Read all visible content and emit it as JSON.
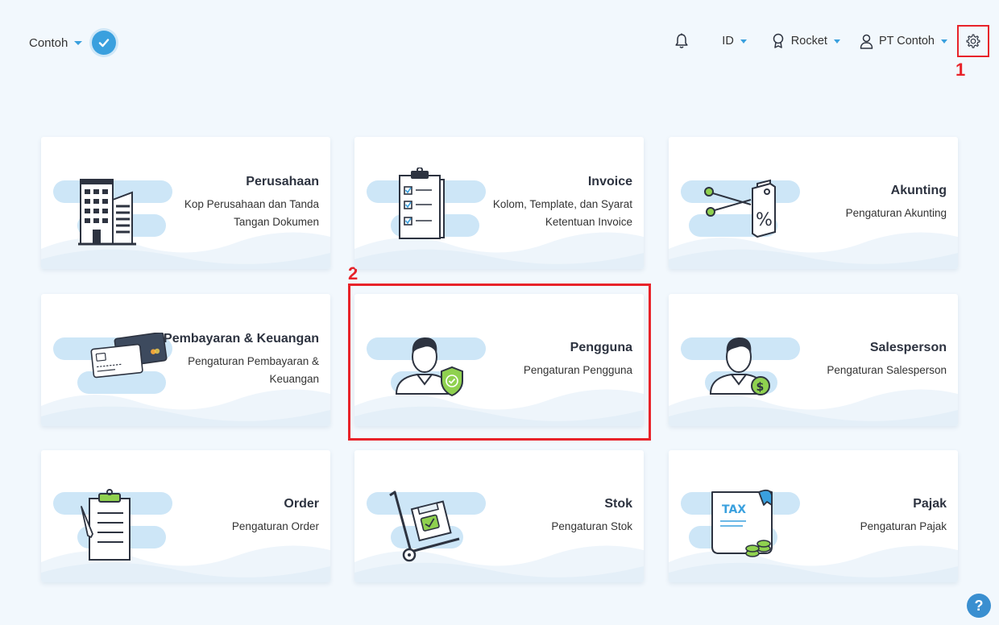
{
  "header": {
    "company_name": "Contoh",
    "language": "ID",
    "plan": "Rocket",
    "user": "PT Contoh"
  },
  "annotations": [
    "1",
    "2"
  ],
  "cards": [
    {
      "title": "Perusahaan",
      "desc": "Kop Perusahaan dan Tanda Tangan Dokumen",
      "icon": "building-icon"
    },
    {
      "title": "Invoice",
      "desc": "Kolom, Template, dan Syarat Ketentuan Invoice",
      "icon": "clipboard-checklist-icon"
    },
    {
      "title": "Akunting",
      "desc": "Pengaturan Akunting",
      "icon": "discount-tag-icon"
    },
    {
      "title": "Pembayaran & Keuangan",
      "desc": "Pengaturan Pembayaran & Keuangan",
      "icon": "credit-cards-icon"
    },
    {
      "title": "Pengguna",
      "desc": "Pengaturan Pengguna",
      "icon": "user-shield-icon"
    },
    {
      "title": "Salesperson",
      "desc": "Pengaturan Salesperson",
      "icon": "salesperson-icon"
    },
    {
      "title": "Order",
      "desc": "Pengaturan Order",
      "icon": "order-clipboard-icon"
    },
    {
      "title": "Stok",
      "desc": "Pengaturan Stok",
      "icon": "hand-truck-icon"
    },
    {
      "title": "Pajak",
      "desc": "Pengaturan Pajak",
      "icon": "tax-document-icon"
    }
  ],
  "tax_icon_text": "TAX",
  "help_label": "?",
  "colors": {
    "accent": "#3aa0de",
    "highlight": "#e8232a",
    "blob": "#cde6f7",
    "wave": "#eef5fb"
  }
}
